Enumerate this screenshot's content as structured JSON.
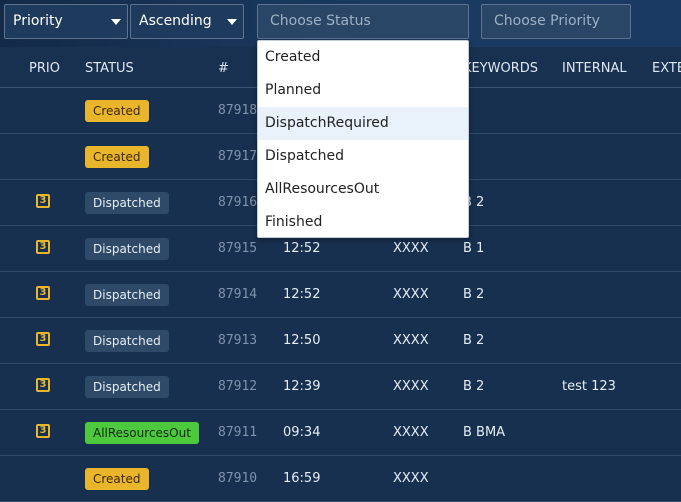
{
  "filters": {
    "sort_field": "Priority",
    "sort_order": "Ascending",
    "status_placeholder": "Choose Status",
    "priority_placeholder": "Choose Priority"
  },
  "status_dropdown": {
    "options": [
      "Created",
      "Planned",
      "DispatchRequired",
      "Dispatched",
      "AllResourcesOut",
      "Finished"
    ],
    "highlighted_option": "DispatchRequired"
  },
  "table": {
    "headers": {
      "prio": "PRIO",
      "status": "STATUS",
      "number": "#",
      "keywords": "KEYWORDS",
      "internal": "INTERNAL",
      "external": "EXTE"
    },
    "rows": [
      {
        "prio": "",
        "status": "Created",
        "number": "87918",
        "time": "",
        "code": "",
        "keywords": "",
        "internal": ""
      },
      {
        "prio": "",
        "status": "Created",
        "number": "87917",
        "time": "",
        "code": "",
        "keywords": "",
        "internal": ""
      },
      {
        "prio": "3",
        "status": "Dispatched",
        "number": "87916",
        "time": "",
        "code": "",
        "keywords": "B 2",
        "internal": ""
      },
      {
        "prio": "3",
        "status": "Dispatched",
        "number": "87915",
        "time": "12:52",
        "code": "XXXX",
        "keywords": "B 1",
        "internal": ""
      },
      {
        "prio": "3",
        "status": "Dispatched",
        "number": "87914",
        "time": "12:52",
        "code": "XXXX",
        "keywords": "B 2",
        "internal": ""
      },
      {
        "prio": "3",
        "status": "Dispatched",
        "number": "87913",
        "time": "12:50",
        "code": "XXXX",
        "keywords": "B 2",
        "internal": ""
      },
      {
        "prio": "3",
        "status": "Dispatched",
        "number": "87912",
        "time": "12:39",
        "code": "XXXX",
        "keywords": "B 2",
        "internal": "test 123"
      },
      {
        "prio": "3",
        "status": "AllResourcesOut",
        "number": "87911",
        "time": "09:34",
        "code": "XXXX",
        "keywords": "B BMA",
        "internal": ""
      },
      {
        "prio": "",
        "status": "Created",
        "number": "87910",
        "time": "16:59",
        "code": "XXXX",
        "keywords": "",
        "internal": ""
      }
    ]
  },
  "colors": {
    "background": "#17304f",
    "status_created": "#e8b52b",
    "status_dispatched": "#2f4a68",
    "status_allresourcesout": "#4cc93d",
    "priority_accent": "#e8b52b"
  }
}
